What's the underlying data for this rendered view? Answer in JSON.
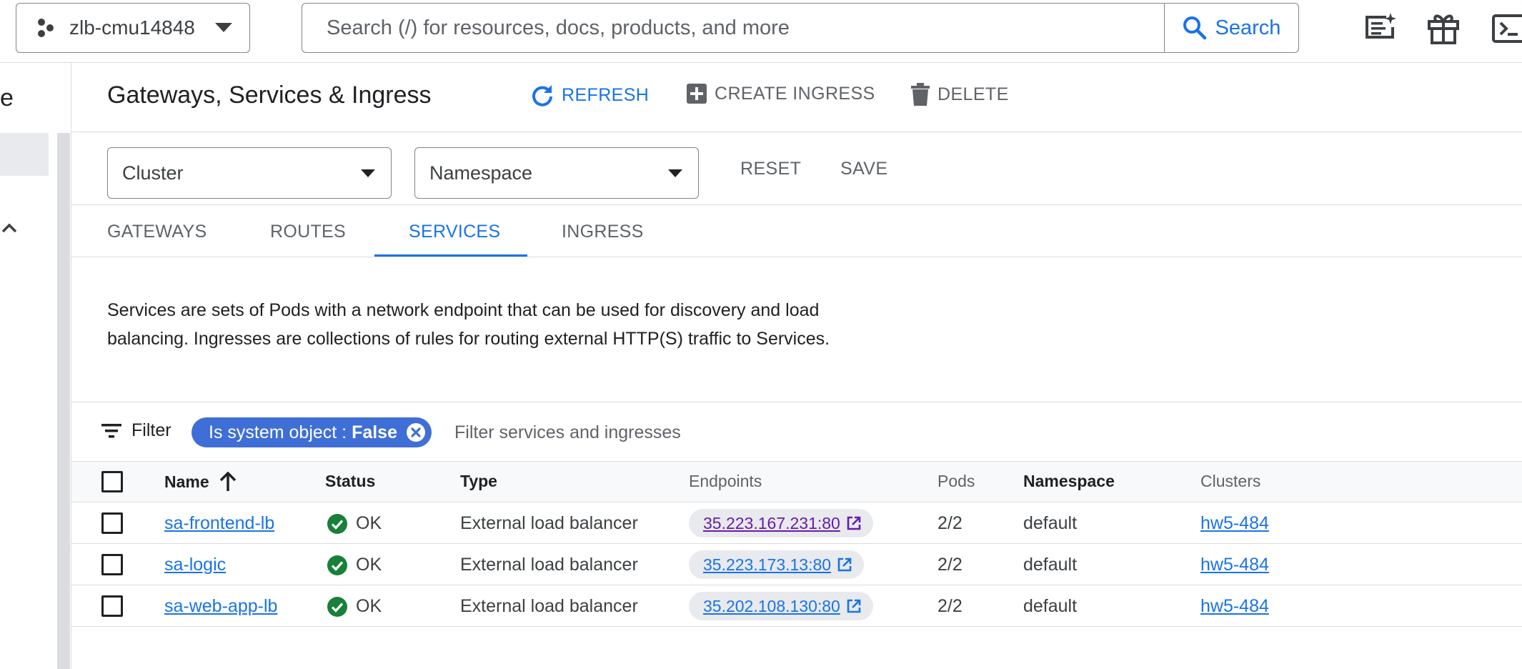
{
  "topbar": {
    "project_name": "zlb-cmu14848",
    "search_placeholder": "Search (/) for resources, docs, products, and more",
    "search_button_label": "Search"
  },
  "left_nav": {
    "partial_label": "e"
  },
  "header": {
    "title": "Gateways, Services & Ingress",
    "refresh_label": "REFRESH",
    "create_ingress_label": "CREATE INGRESS",
    "delete_label": "DELETE"
  },
  "filters": {
    "cluster_label": "Cluster",
    "namespace_label": "Namespace",
    "reset_label": "RESET",
    "save_label": "SAVE"
  },
  "tabs": [
    {
      "label": "GATEWAYS"
    },
    {
      "label": "ROUTES"
    },
    {
      "label": "SERVICES",
      "active": true
    },
    {
      "label": "INGRESS"
    }
  ],
  "description": "Services are sets of Pods with a network endpoint that can be used for discovery and load balancing. Ingresses are collections of rules for routing external HTTP(S) traffic to Services.",
  "filter_bar": {
    "label": "Filter",
    "chip_key": "Is system object : ",
    "chip_value": "False",
    "placeholder": "Filter services and ingresses"
  },
  "table": {
    "columns": [
      "Name",
      "Status",
      "Type",
      "Endpoints",
      "Pods",
      "Namespace",
      "Clusters"
    ],
    "rows": [
      {
        "name": "sa-frontend-lb",
        "status": "OK",
        "type": "External load balancer",
        "endpoint": "35.223.167.231:80",
        "pods": "2/2",
        "namespace": "default",
        "cluster": "hw5-484"
      },
      {
        "name": "sa-logic",
        "status": "OK",
        "type": "External load balancer",
        "endpoint": "35.223.173.13:80",
        "pods": "2/2",
        "namespace": "default",
        "cluster": "hw5-484"
      },
      {
        "name": "sa-web-app-lb",
        "status": "OK",
        "type": "External load balancer",
        "endpoint": "35.202.108.130:80",
        "pods": "2/2",
        "namespace": "default",
        "cluster": "hw5-484"
      }
    ]
  },
  "colors": {
    "accent": "#1a73e8",
    "chip": "#3f6fd6",
    "ok_green": "#188038",
    "visited_link": "#681da8"
  }
}
